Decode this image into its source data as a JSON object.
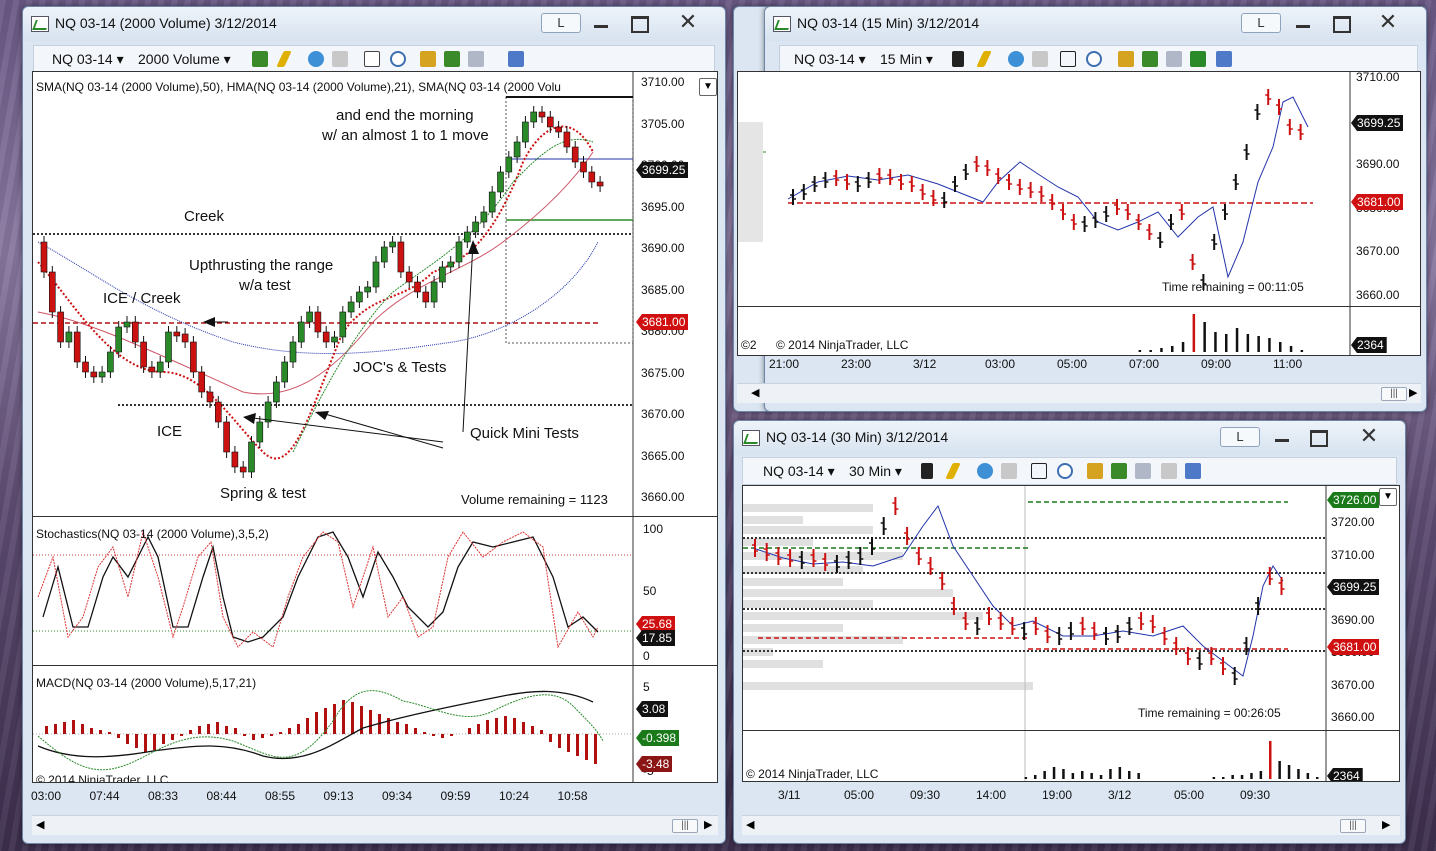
{
  "windows": {
    "left": {
      "title": "NQ 03-14 (2000 Volume)  3/12/2014",
      "btn_l": "L",
      "instrument": "NQ 03-14",
      "period": "2000 Volume",
      "indicators_label": "SMA(NQ 03-14  (2000  Volume),50),  HMA(NQ 03-14  (2000  Volume),21),  SMA(NQ 03-14  (2000  Volu",
      "price_ticks": [
        "3710.00",
        "3705.00",
        "3700.00",
        "3695.00",
        "3690.00",
        "3685.00",
        "3680.00",
        "3675.00",
        "3670.00",
        "3665.00",
        "3660.00"
      ],
      "last_price": "3699.25",
      "line_price": "3681.00",
      "volume_remaining": "Volume remaining = 1123",
      "annotations": {
        "end_morning_1": "and end the morning",
        "end_morning_2": "w/ an almost 1 to 1 move",
        "creek": "Creek",
        "upthrust_1": "Upthrusting the range",
        "upthrust_2": "w/a test",
        "ice_creek": "ICE / Creek",
        "jocs": "JOC's & Tests",
        "ice": "ICE",
        "quick_mini": "Quick Mini Tests",
        "spring": "Spring & test"
      },
      "stoch_label": "Stochastics(NQ 03-14  (2000 Volume),3,5,2)",
      "stoch_ticks": [
        "100",
        "50",
        "0"
      ],
      "stoch_values": [
        "25.68",
        "17.85"
      ],
      "macd_label": "MACD(NQ 03-14  (2000 Volume),5,17,21)",
      "macd_ticks": [
        "5",
        "-5"
      ],
      "macd_values": [
        "3.08",
        "-0.398",
        "-3.48"
      ],
      "copyright": "© 2014 NinjaTrader, LLC",
      "time_ticks": [
        "03:00",
        "07:44",
        "08:33",
        "08:44",
        "08:55",
        "09:13",
        "09:34",
        "09:59",
        "10:24",
        "10:58"
      ]
    },
    "top_right": {
      "title": "NQ 03-14 (15 Min)  3/12/2014",
      "btn_l": "L",
      "instrument": "NQ 03-14",
      "period": "15 Min",
      "price_ticks": [
        "3710.00",
        "3700.00",
        "3690.00",
        "3680.00",
        "3670.00",
        "3660.00"
      ],
      "last_price": "3699.25",
      "line_price": "3681.00",
      "time_remaining": "Time remaining = 00:11:05",
      "volume_value": "2364",
      "copyright": "© 2014 NinjaTrader, LLC",
      "copyright_prefix": "©2",
      "time_ticks": [
        "21:00",
        "23:00",
        "3/12",
        "03:00",
        "05:00",
        "07:00",
        "09:00",
        "11:00"
      ]
    },
    "bottom_right": {
      "title": "NQ 03-14 (30 Min)  3/12/2014",
      "btn_l": "L",
      "instrument": "NQ 03-14",
      "period": "30 Min",
      "price_ticks": [
        "3720.00",
        "3710.00",
        "3700.00",
        "3690.00",
        "3680.00",
        "3670.00",
        "3660.00"
      ],
      "top_price": "3726.00",
      "last_price": "3699.25",
      "line_price": "3681.00",
      "time_remaining": "Time remaining = 00:26:05",
      "volume_value": "2364",
      "copyright": "© 2014 NinjaTrader, LLC",
      "time_ticks": [
        "3/11",
        "05:00",
        "09:30",
        "14:00",
        "19:00",
        "3/12",
        "05:00",
        "09:30"
      ]
    }
  },
  "colors": {
    "up_candle": "#2a8a2a",
    "down_candle": "#cc1111",
    "line_tag_red": "#d01010",
    "tag_black": "#111111",
    "tag_green": "#1a7a1a",
    "tag_darkred": "#8b1414"
  }
}
